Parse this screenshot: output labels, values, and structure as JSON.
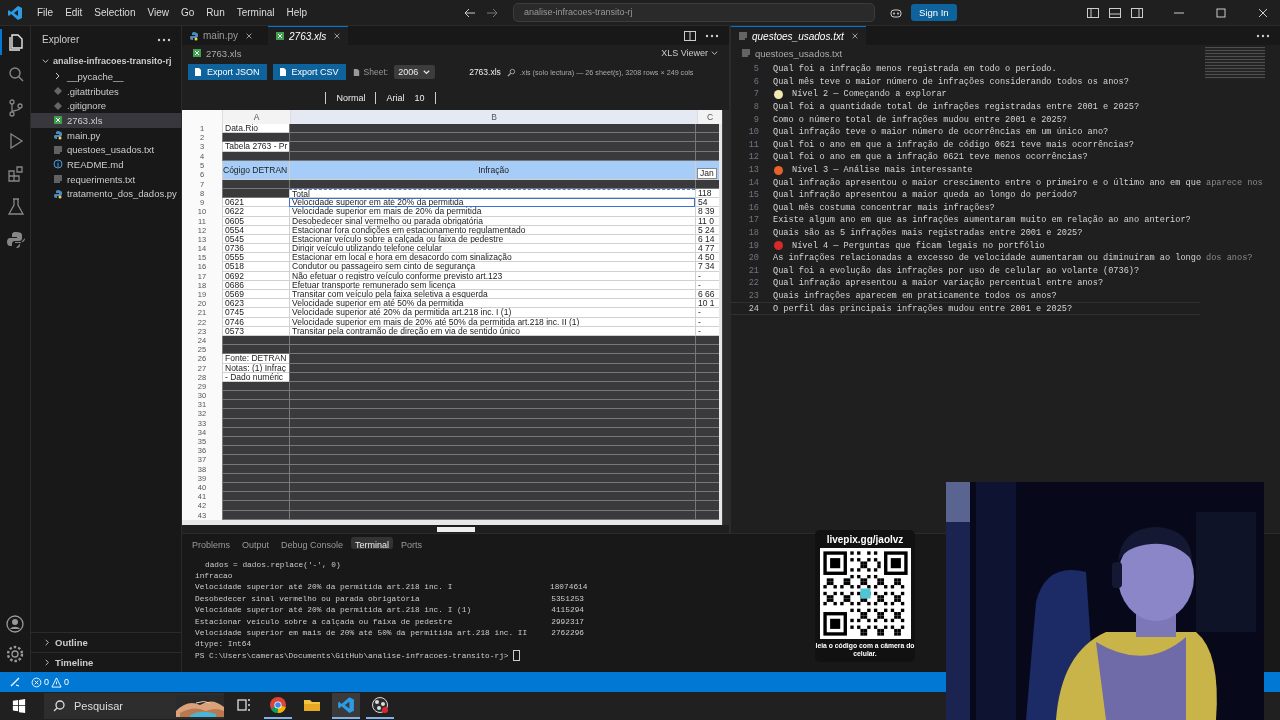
{
  "title_bar": {
    "menu": [
      "File",
      "Edit",
      "Selection",
      "View",
      "Go",
      "Run",
      "Terminal",
      "Help"
    ],
    "command_center": "analise-infracoes-transito-rj",
    "sign_in": "Sign In"
  },
  "activity_bar": [
    {
      "kind": "files",
      "selected": true
    },
    {
      "kind": "search",
      "selected": false
    },
    {
      "kind": "source-control",
      "selected": false
    },
    {
      "kind": "run",
      "selected": false
    },
    {
      "kind": "extensions",
      "selected": false
    },
    {
      "kind": "testing",
      "selected": false
    },
    {
      "kind": "python",
      "selected": false
    }
  ],
  "sidebar": {
    "title": "Explorer",
    "folder": {
      "name": "analise-infracoes-transito-rj",
      "expanded": true,
      "children": [
        {
          "name": "__pycache__",
          "kind": "folder",
          "expanded": false,
          "selected": false
        },
        {
          "name": ".gitattributes",
          "kind": "git",
          "selected": false
        },
        {
          "name": ".gitignore",
          "kind": "git",
          "selected": false
        },
        {
          "name": "2763.xls",
          "kind": "excel",
          "selected": true
        },
        {
          "name": "main.py",
          "kind": "python",
          "selected": false
        },
        {
          "name": "questoes_usados.txt",
          "kind": "text",
          "selected": false
        },
        {
          "name": "README.md",
          "kind": "info",
          "selected": false
        },
        {
          "name": "requeriments.txt",
          "kind": "text",
          "selected": false
        },
        {
          "name": "tratamento_dos_dados.py",
          "kind": "python",
          "selected": false
        }
      ]
    },
    "sections": [
      {
        "name": "Outline",
        "expanded": false
      },
      {
        "name": "Timeline",
        "expanded": false
      }
    ]
  },
  "left_editor": {
    "tabs": [
      {
        "label": "main.py",
        "kind": "python",
        "selected": false
      },
      {
        "label": "2763.xls",
        "kind": "excel",
        "selected": true
      }
    ],
    "breadcrumb": "2763.xls",
    "viewer": "XLS Viewer",
    "buttons": [
      "Export JSON",
      "Export CSV"
    ],
    "sheet_label": "Sheet:",
    "sheet": "2006",
    "file_name": "2763.xls",
    "info": ".xls (solo lectura) — 26 sheet(s), 3208 rows × 249 cols",
    "format": [
      "Normal",
      "Arial",
      "10"
    ],
    "grid": {
      "columns": [
        "A",
        "B",
        "C"
      ],
      "rows": [
        {
          "n": "1",
          "kind": "label",
          "a": "Data.Rio"
        },
        {
          "n": "2",
          "kind": "empty"
        },
        {
          "n": "3",
          "kind": "label",
          "a": "Tabela 2763 - Pr"
        },
        {
          "n": "4",
          "kind": "empty"
        },
        {
          "n": "5",
          "n2": "6",
          "kind": "header",
          "a": "Cógigo DETRAN",
          "b": "Infração",
          "c": "Jan"
        },
        {
          "n": "7",
          "kind": "empty"
        },
        {
          "n": "8",
          "kind": "total",
          "b": "Total",
          "c": "118"
        },
        {
          "n": "9",
          "kind": "data",
          "a": "0621",
          "b": "Velocidade superior em até 20% da permitida",
          "c": "54",
          "selected": true
        },
        {
          "n": "10",
          "kind": "data",
          "a": "0622",
          "b": "Velocidade superior em mais de 20% da permitida",
          "c": "8 39",
          "selected": false
        },
        {
          "n": "11",
          "kind": "data",
          "a": "0605",
          "b": "Desobedecer sinal vermelho ou parada obrigatória",
          "c": "11 0",
          "selected": false
        },
        {
          "n": "12",
          "kind": "data",
          "a": "0554",
          "b": "Estacionar fora condições em estacionamento regulamentado",
          "c": "5 24",
          "selected": false
        },
        {
          "n": "13",
          "kind": "data",
          "a": "0545",
          "b": "Estacionar veículo sobre a calçada ou faixa de pedestre",
          "c": "6 14",
          "selected": false
        },
        {
          "n": "14",
          "kind": "data",
          "a": "0736",
          "b": "Dirigir veículo utilizando telefone celular",
          "c": "4 77",
          "selected": false
        },
        {
          "n": "15",
          "kind": "data",
          "a": "0555",
          "b": "Estacionar em local e hora em desacordo com sinalização",
          "c": "4 50",
          "selected": false
        },
        {
          "n": "16",
          "kind": "data",
          "a": "0518",
          "b": "Condutor ou passageiro sem cinto de segurança",
          "c": "7 34",
          "selected": false
        },
        {
          "n": "17",
          "kind": "data",
          "a": "0692",
          "b": "Não efetuar o registro veículo conforme previsto art.123",
          "c": "-",
          "selected": false
        },
        {
          "n": "18",
          "kind": "data",
          "a": "0686",
          "b": "Efetuar transporte remunerado sem licença",
          "c": "-",
          "selected": false
        },
        {
          "n": "19",
          "kind": "data",
          "a": "0569",
          "b": "Transitar com veículo pela faixa seletiva a esquerda",
          "c": "6 66",
          "selected": false
        },
        {
          "n": "20",
          "kind": "data",
          "a": "0623",
          "b": "Velocidade superior em até 50% da permitida",
          "c": "10 1",
          "selected": false
        },
        {
          "n": "21",
          "kind": "data",
          "a": "0745",
          "b": "Velocidade superior até 20% da permitida art.218 inc. I (1)",
          "c": "-",
          "selected": false
        },
        {
          "n": "22",
          "kind": "data",
          "a": "0746",
          "b": "Velocidade superior em mais de 20% até 50% da permitida art.218 inc. II (1)",
          "c": "-",
          "selected": false
        },
        {
          "n": "23",
          "kind": "data",
          "a": "0573",
          "b": "Transitar pela contramão de direção em via de sentido único",
          "c": "-",
          "selected": false
        },
        {
          "n": "24",
          "kind": "empty"
        },
        {
          "n": "25",
          "kind": "empty"
        },
        {
          "n": "26",
          "kind": "label",
          "a": "Fonte: DETRAN"
        },
        {
          "n": "27",
          "kind": "label",
          "a": "Notas: (1) Infraç"
        },
        {
          "n": "28",
          "kind": "label",
          "a": "- Dado numéric"
        },
        {
          "n": "29",
          "kind": "empty"
        },
        {
          "n": "30",
          "kind": "empty"
        },
        {
          "n": "31",
          "kind": "empty"
        },
        {
          "n": "32",
          "kind": "empty"
        },
        {
          "n": "33",
          "kind": "empty"
        },
        {
          "n": "34",
          "kind": "empty"
        },
        {
          "n": "35",
          "kind": "empty"
        },
        {
          "n": "36",
          "kind": "empty"
        },
        {
          "n": "37",
          "kind": "empty"
        },
        {
          "n": "38",
          "kind": "empty"
        },
        {
          "n": "39",
          "kind": "empty"
        },
        {
          "n": "40",
          "kind": "empty"
        },
        {
          "n": "41",
          "kind": "empty"
        },
        {
          "n": "42",
          "kind": "empty"
        },
        {
          "n": "43",
          "kind": "empty"
        }
      ]
    }
  },
  "right_editor": {
    "tabs": [
      {
        "label": "questoes_usados.txt",
        "kind": "text",
        "selected": true
      }
    ],
    "breadcrumb": "questoes_usados.txt",
    "lines": [
      {
        "n": "5",
        "kind": "plain",
        "text": "Qual foi a infração menos registrada em todo o período."
      },
      {
        "n": "6",
        "kind": "plain",
        "text": "Qual mês teve o maior número de infrações considerando todos os anos?"
      },
      {
        "n": "7",
        "kind": "heading",
        "color": "#f3e9b0",
        "text": "Nível 2 — Começando a explorar"
      },
      {
        "n": "8",
        "kind": "plain",
        "text": "Qual foi a quantidade total de infrações registradas entre 2001 e 2025?"
      },
      {
        "n": "9",
        "kind": "plain",
        "text": "Como o número total de infrações mudou entre 2001 e 2025?"
      },
      {
        "n": "10",
        "kind": "plain",
        "text": "Qual infração teve o maior número de ocorrências em um único ano?"
      },
      {
        "n": "11",
        "kind": "plain",
        "text": "Qual foi o ano em que a infração de código 0621 teve mais ocorrências?"
      },
      {
        "n": "12",
        "kind": "plain",
        "text": "Qual foi o ano em que a infração 0621 teve menos ocorrências?"
      },
      {
        "n": "13",
        "kind": "heading",
        "color": "#e8632b",
        "text": "Nível 3 — Análise mais interessante"
      },
      {
        "n": "14",
        "kind": "plain",
        "text": "Qual infração apresentou o maior crescimento entre o primeiro e o último ano em que",
        "ghost": "aparece nos"
      },
      {
        "n": "15",
        "kind": "plain",
        "text": "Qual infração apresentou a maior queda ao longo do período?"
      },
      {
        "n": "16",
        "kind": "plain",
        "text": "Qual mês costuma concentrar mais infrações?"
      },
      {
        "n": "17",
        "kind": "plain",
        "text": "Existe algum ano em que as infrações aumentaram muito em relação ao ano anterior?"
      },
      {
        "n": "18",
        "kind": "plain",
        "text": "Quais são as 5 infrações mais registradas entre 2001 e 2025?"
      },
      {
        "n": "19",
        "kind": "heading",
        "color": "#d62a2a",
        "text": "Nível 4 — Perguntas que ficam legais no portfólio"
      },
      {
        "n": "20",
        "kind": "plain",
        "text": "As infrações relacionadas a excesso de velocidade aumentaram ou diminuíram ao longo",
        "ghost": "dos anos?"
      },
      {
        "n": "21",
        "kind": "plain",
        "text": "Qual foi a evolução das infrações por uso de celular ao volante (0736)?"
      },
      {
        "n": "22",
        "kind": "plain",
        "text": "Qual infração apresentou a maior variação percentual entre anos?"
      },
      {
        "n": "23",
        "kind": "plain",
        "text": "Quais infrações aparecem em praticamente todos os anos?"
      },
      {
        "n": "24",
        "kind": "current",
        "text": "O perfil das principais infrações mudou entre 2001 e 2025?"
      }
    ]
  },
  "panel": {
    "tabs": [
      {
        "label": "Problems",
        "selected": false
      },
      {
        "label": "Output",
        "selected": false
      },
      {
        "label": "Debug Console",
        "selected": false
      },
      {
        "label": "Terminal",
        "selected": true
      },
      {
        "label": "Ports",
        "selected": false
      }
    ],
    "terminal": [
      {
        "kind": "indented",
        "text": "dados = dados.replace('-', 0)"
      },
      {
        "kind": "plain",
        "text": "infracao"
      },
      {
        "kind": "plain",
        "text": "Velocidade superior até 20% da permitida art.218 inc. I",
        "value": "18074614"
      },
      {
        "kind": "plain",
        "text": "Desobedecer sinal vermelho ou parada obrigatória",
        "value": "5351253"
      },
      {
        "kind": "plain",
        "text": "Velocidade superior até 20% da permitida art.218 inc. I (1)",
        "value": "4115294"
      },
      {
        "kind": "plain",
        "text": "Estacionar veículo sobre a calçada ou faixa de pedestre",
        "value": "2992317"
      },
      {
        "kind": "plain",
        "text": "Velocidade superior em mais de 20% até 50% da permitida art.218 inc. II",
        "value": "2762296"
      },
      {
        "kind": "plain",
        "text": "dtype: Int64"
      },
      {
        "kind": "prompt",
        "text": "PS C:\\Users\\cameras\\Documents\\GitHub\\analise-infracoes-transito-rj>"
      }
    ]
  },
  "status_bar": {
    "errors": "0",
    "warnings": "0"
  },
  "taskbar": {
    "search": "Pesquisar",
    "apps": [
      {
        "kind": "task-view",
        "running": false,
        "selected": false
      },
      {
        "kind": "chrome",
        "running": true,
        "selected": false
      },
      {
        "kind": "files",
        "running": false,
        "selected": false
      },
      {
        "kind": "vscode",
        "running": true,
        "selected": true
      },
      {
        "kind": "obs",
        "running": true,
        "selected": false
      }
    ]
  },
  "overlay": {
    "qr": {
      "url": "livepix.gg/jaolvz",
      "caption": "leia o código com a câmera do celular."
    }
  }
}
